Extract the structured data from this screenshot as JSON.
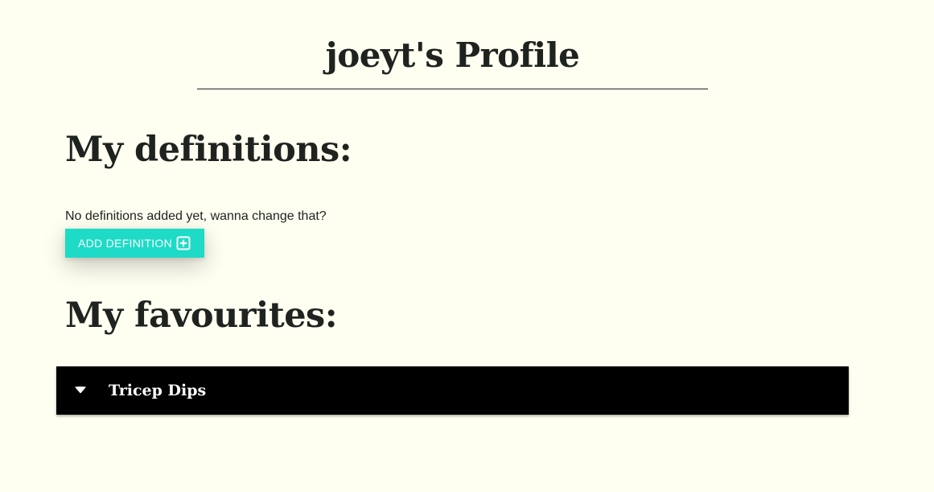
{
  "profile": {
    "title": "joeyt's Profile"
  },
  "definitions": {
    "heading": "My definitions:",
    "empty_message": "No definitions added yet, wanna change that?",
    "add_button_label": "ADD DEFINITION",
    "add_button_icon": "plus-square-icon"
  },
  "favourites": {
    "heading": "My favourites:",
    "items": [
      {
        "name": "Tricep Dips",
        "icon": "caret-down-icon"
      }
    ]
  },
  "colors": {
    "background": "#fffff1",
    "text": "#1f2320",
    "accent_button": "#1ddbc6",
    "favourite_bar": "#000000"
  }
}
